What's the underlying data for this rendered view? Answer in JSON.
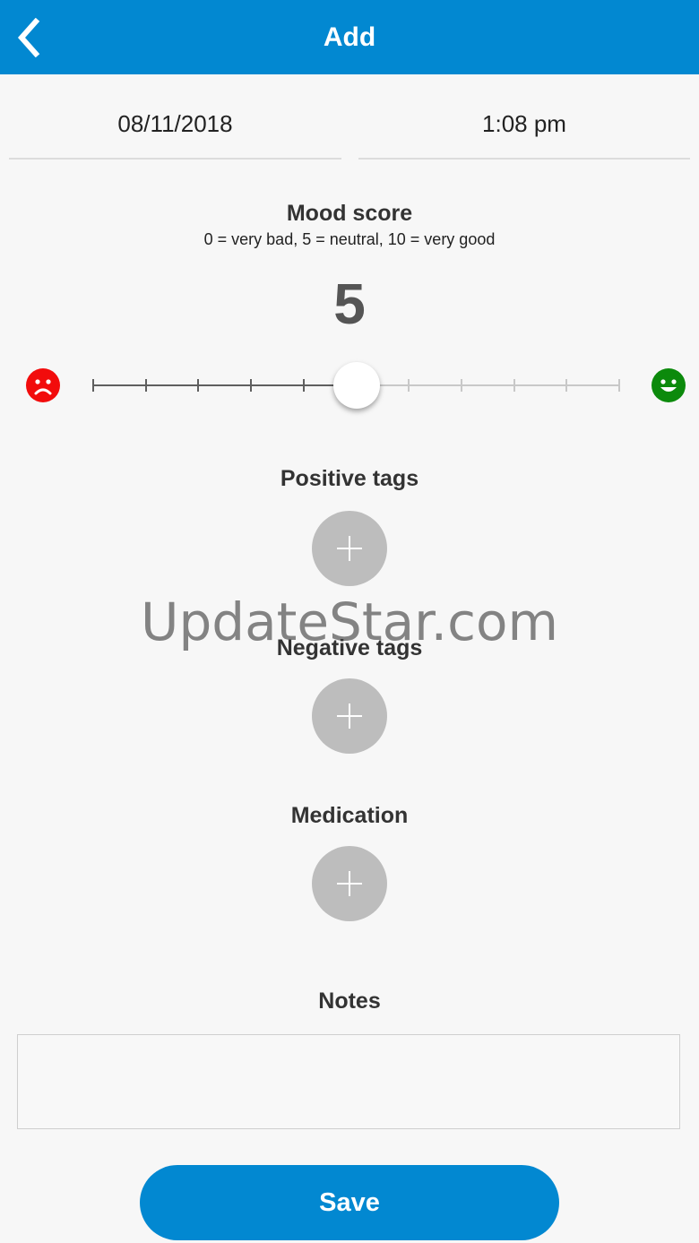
{
  "app_bar": {
    "title": "Add",
    "back_icon": "chevron-left-icon",
    "background": "#0288d1"
  },
  "entry": {
    "date": "08/11/2018",
    "time": "1:08 pm"
  },
  "mood": {
    "title": "Mood score",
    "scale_hint": "0 = very bad, 5 = neutral, 10 = very good",
    "score": "5",
    "slider": {
      "min": 0,
      "max": 10,
      "value": 5,
      "step": 1
    },
    "sad_icon": "sad-face-icon",
    "sad_color": "#f20c0c",
    "happy_icon": "happy-face-icon",
    "happy_color": "#0c8a0c"
  },
  "positive_tags": {
    "title": "Positive tags",
    "add_icon": "plus-icon"
  },
  "negative_tags": {
    "title": "Negative tags",
    "add_icon": "plus-icon"
  },
  "medication": {
    "title": "Medication",
    "add_icon": "plus-icon"
  },
  "notes": {
    "title": "Notes",
    "value": "",
    "placeholder": ""
  },
  "save": {
    "label": "Save",
    "color": "#0288d1"
  },
  "watermark": "UpdateStar.com"
}
